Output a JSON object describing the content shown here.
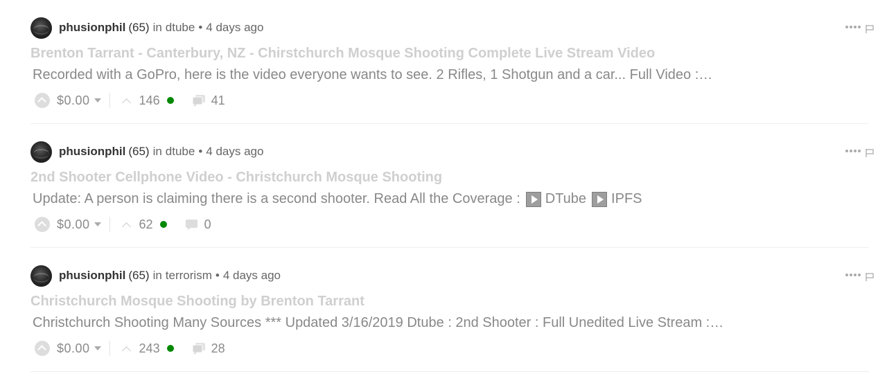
{
  "posts": [
    {
      "author": "phusionphil",
      "reputation": "(65)",
      "in_label": "in",
      "community": "dtube",
      "separator": "•",
      "time": "4 days ago",
      "title": "Brenton Tarrant - Canterbury, NZ - Chirstchurch Mosque Shooting Complete Live Stream Video",
      "body": "Recorded with a GoPro, here is the video everyone wants to see. 2 Rifles, 1 Shotgun and a car... Full Video :…",
      "payout": "$0.00",
      "votes": "146",
      "comments": "41"
    },
    {
      "author": "phusionphil",
      "reputation": "(65)",
      "in_label": "in",
      "community": "dtube",
      "separator": "•",
      "time": "4 days ago",
      "title": "2nd Shooter Cellphone Video - Christchurch Mosque Shooting",
      "body": "Update: A person is claiming there is a second shooter. Read All the Coverage :",
      "body_link_1": "DTube",
      "body_link_2": "IPFS",
      "payout": "$0.00",
      "votes": "62",
      "comments": "0"
    },
    {
      "author": "phusionphil",
      "reputation": "(65)",
      "in_label": "in",
      "community": "terrorism",
      "separator": "•",
      "time": "4 days ago",
      "title": "Christchurch Mosque Shooting by Brenton Tarrant",
      "body": "Christchurch Shooting Many Sources *** Updated 3/16/2019 Dtube : 2nd Shooter : Full Unedited Live Stream :…",
      "payout": "$0.00",
      "votes": "243",
      "comments": "28"
    }
  ],
  "colors": {
    "title": "#cfcfcf",
    "body": "#888888",
    "author": "#333333",
    "status_dot": "#008800"
  },
  "icons": [
    "avatar",
    "more-menu-icon",
    "flag-icon",
    "upvote-icon",
    "caret-down-icon",
    "vote-chevron-icon",
    "comments-icon",
    "play-icon"
  ]
}
